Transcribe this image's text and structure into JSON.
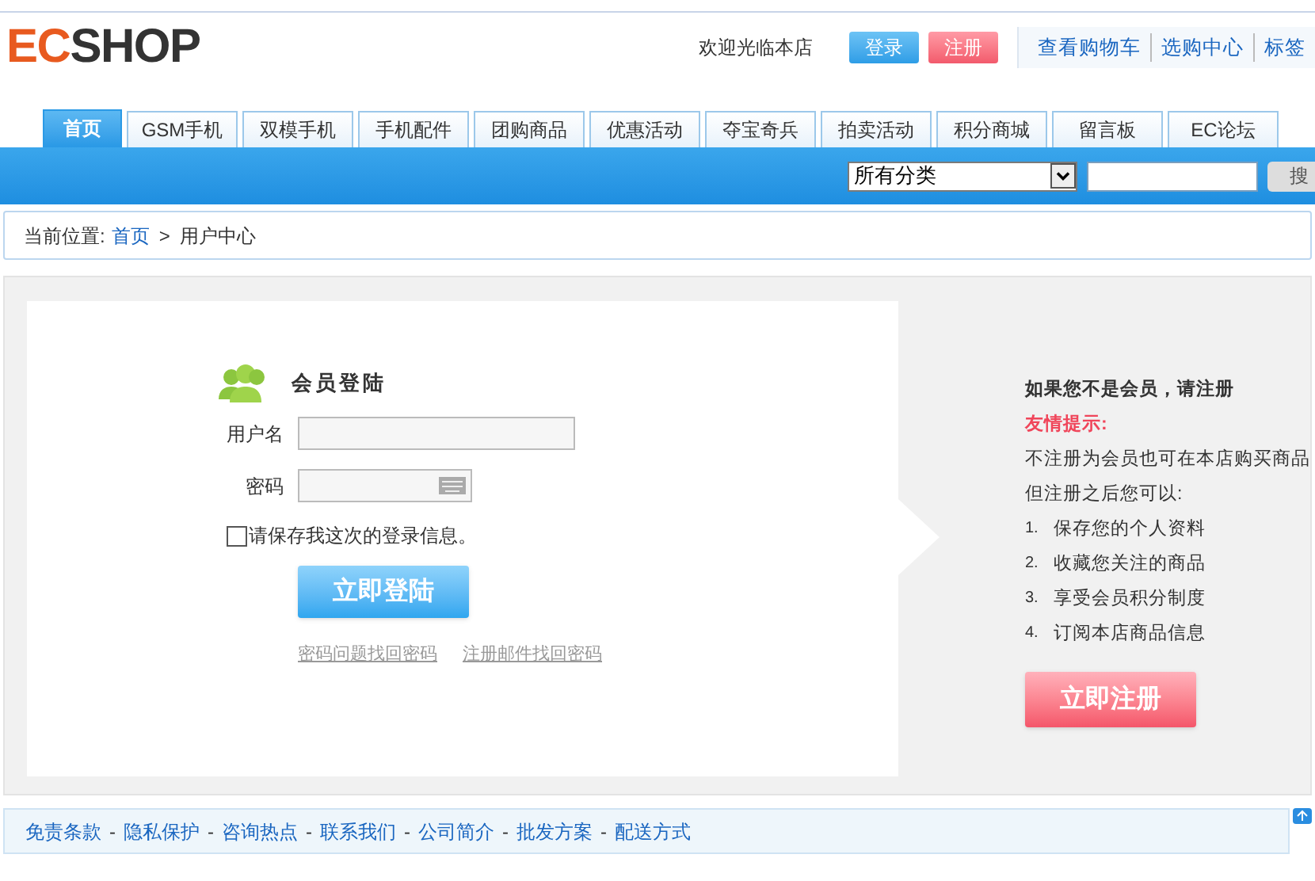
{
  "header": {
    "logo": "ECSHOP",
    "welcome": "欢迎光临本店",
    "login_button": "登录",
    "register_button": "注册",
    "links": [
      "查看购物车",
      "选购中心",
      "标签"
    ]
  },
  "nav": {
    "tabs": [
      {
        "label": "首页",
        "selected": true
      },
      {
        "label": "GSM手机",
        "selected": false
      },
      {
        "label": "双模手机",
        "selected": false
      },
      {
        "label": "手机配件",
        "selected": false
      },
      {
        "label": "团购商品",
        "selected": false
      },
      {
        "label": "优惠活动",
        "selected": false
      },
      {
        "label": "夺宝奇兵",
        "selected": false
      },
      {
        "label": "拍卖活动",
        "selected": false
      },
      {
        "label": "积分商城",
        "selected": false
      },
      {
        "label": "留言板",
        "selected": false
      },
      {
        "label": "EC论坛",
        "selected": false
      }
    ]
  },
  "search": {
    "category": "所有分类",
    "button": "搜"
  },
  "breadcrumb": {
    "label": "当前位置:",
    "home": "首页",
    "separator": ">",
    "current": "用户中心"
  },
  "login": {
    "title": "会员登陆",
    "username_label": "用户名",
    "password_label": "密码",
    "remember": {
      "label": "请保存我这次的登录信息。",
      "checked": false
    },
    "submit": "立即登陆",
    "links": [
      "密码问题找回密码",
      "注册邮件找回密码"
    ]
  },
  "register": {
    "title": "如果您不是会员，请注册",
    "tip_title": "友情提示:",
    "intro": [
      "不注册为会员也可在本店购买商品",
      "但注册之后您可以:"
    ],
    "benefits": [
      {
        "number": "1.",
        "text": "保存您的个人资料"
      },
      {
        "number": "2.",
        "text": "收藏您关注的商品"
      },
      {
        "number": "3.",
        "text": "享受会员积分制度"
      },
      {
        "number": "4.",
        "text": "订阅本店商品信息"
      }
    ],
    "button": "立即注册"
  },
  "footer": {
    "links": [
      "免责条款",
      "隐私保护",
      "咨询热点",
      "联系我们",
      "公司简介",
      "批发方案",
      "配送方式"
    ],
    "separator": "-"
  }
}
